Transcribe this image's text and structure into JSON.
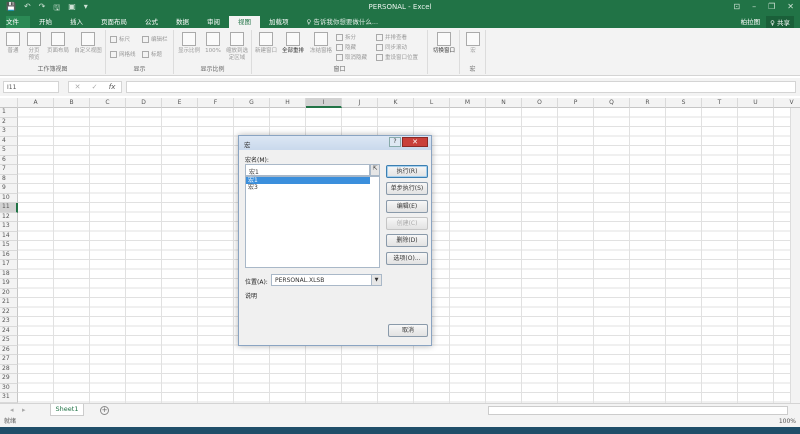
{
  "window": {
    "title": "PERSONAL - Excel",
    "qat": [
      "💾",
      "↶",
      "↷",
      "🖫",
      "▣",
      "▾"
    ],
    "controls": [
      "⊡",
      "–",
      "❐",
      "✕"
    ]
  },
  "tabs": [
    {
      "label": "文件"
    },
    {
      "label": "开始"
    },
    {
      "label": "插入"
    },
    {
      "label": "页面布局"
    },
    {
      "label": "公式"
    },
    {
      "label": "数据"
    },
    {
      "label": "审阅"
    },
    {
      "label": "视图",
      "active": true
    },
    {
      "label": "加载项"
    },
    {
      "label": "♀ 告诉我你想要做什么..."
    }
  ],
  "user": {
    "name": "柏拉图",
    "share": "♀ 共享"
  },
  "ribbon": {
    "workbook_views": {
      "label": "工作簿视图",
      "buttons": [
        "普通",
        "分页预览",
        "页面布局",
        "自定义视图"
      ]
    },
    "show": {
      "label": "显示",
      "checks": [
        "标尺",
        "编辑栏",
        "网格线",
        "标题"
      ]
    },
    "zoom": {
      "label": "显示比例",
      "buttons": [
        "显示比例",
        "100%",
        "缩放到选定区域"
      ]
    },
    "window": {
      "label": "窗口",
      "buttons": [
        "新建窗口",
        "全部重排",
        "冻结窗格"
      ],
      "small": [
        "拆分",
        "隐藏",
        "取消隐藏",
        "并排查看",
        "同步滚动",
        "重设窗口位置"
      ],
      "switch": "切换窗口"
    },
    "macros": {
      "label": "宏",
      "button": "宏"
    }
  },
  "formula_bar": {
    "name_box": "I11",
    "cancel": "✕",
    "enter": "✓",
    "fx": "fx",
    "value": ""
  },
  "grid": {
    "columns": [
      "A",
      "B",
      "C",
      "D",
      "E",
      "F",
      "G",
      "H",
      "I",
      "J",
      "K",
      "L",
      "M",
      "N",
      "O",
      "P",
      "Q",
      "R",
      "S",
      "T",
      "U",
      "V"
    ],
    "rows": 31,
    "selected_col": "I",
    "selected_row": 11
  },
  "dialog": {
    "title": "宏",
    "help": "?",
    "close": "✕",
    "macro_name_label": "宏名(M):",
    "macro_name_value": "宏1",
    "macros": [
      "宏1",
      "宏3"
    ],
    "selected_macro": "宏1",
    "buttons": {
      "run": "执行(R)",
      "step": "单步执行(S)",
      "edit": "编辑(E)",
      "create": "创建(C)",
      "delete": "删除(D)",
      "options": "选项(O)..."
    },
    "location_label": "位置(A):",
    "location_value": "PERSONAL.XLSB",
    "description_label": "说明",
    "cancel": "取消"
  },
  "sheets": {
    "tabs": [
      "Sheet1"
    ],
    "add": "+"
  },
  "status": {
    "text": "就绪",
    "zoom": "100%"
  }
}
